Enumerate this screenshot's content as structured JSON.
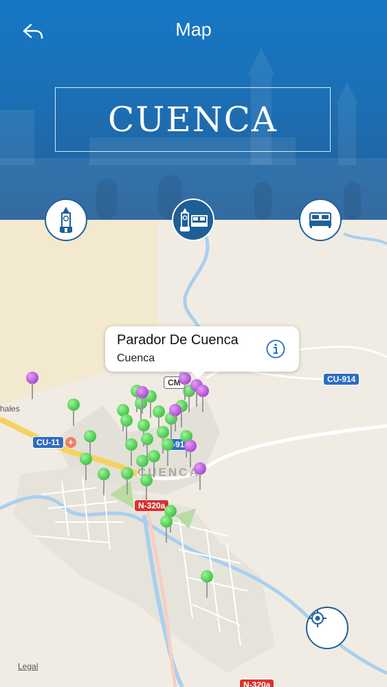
{
  "header": {
    "title": "Map",
    "back_icon": "back-arrow-icon",
    "city_name": "CUENCA"
  },
  "categories": [
    {
      "name": "attractions",
      "icon": "clock-tower-icon",
      "active": false
    },
    {
      "name": "all",
      "icon": "tower-and-bed-icon",
      "active": true
    },
    {
      "name": "hotels",
      "icon": "bed-icon",
      "active": false
    }
  ],
  "map": {
    "callout": {
      "title": "Parador De Cuenca",
      "subtitle": "Cuenca",
      "info_icon": "info-icon"
    },
    "road_labels": {
      "cu914": "CU-914",
      "cu11": "CU-11",
      "n320a": "N-320a",
      "n320a_bottom": "N-320a",
      "cm": "CM",
      "r91": "-91"
    },
    "place_label": "CUENCA",
    "edge_label": "hales",
    "legal": "Legal",
    "locate_icon": "locate-crosshair-icon"
  },
  "colors": {
    "header_blue": "#1c6fb4",
    "accent": "#1f5f97",
    "pin_green": "#49c84b",
    "pin_purple": "#b24fd9",
    "road_blue": "#2f6cc2",
    "road_red": "#d8332f"
  }
}
